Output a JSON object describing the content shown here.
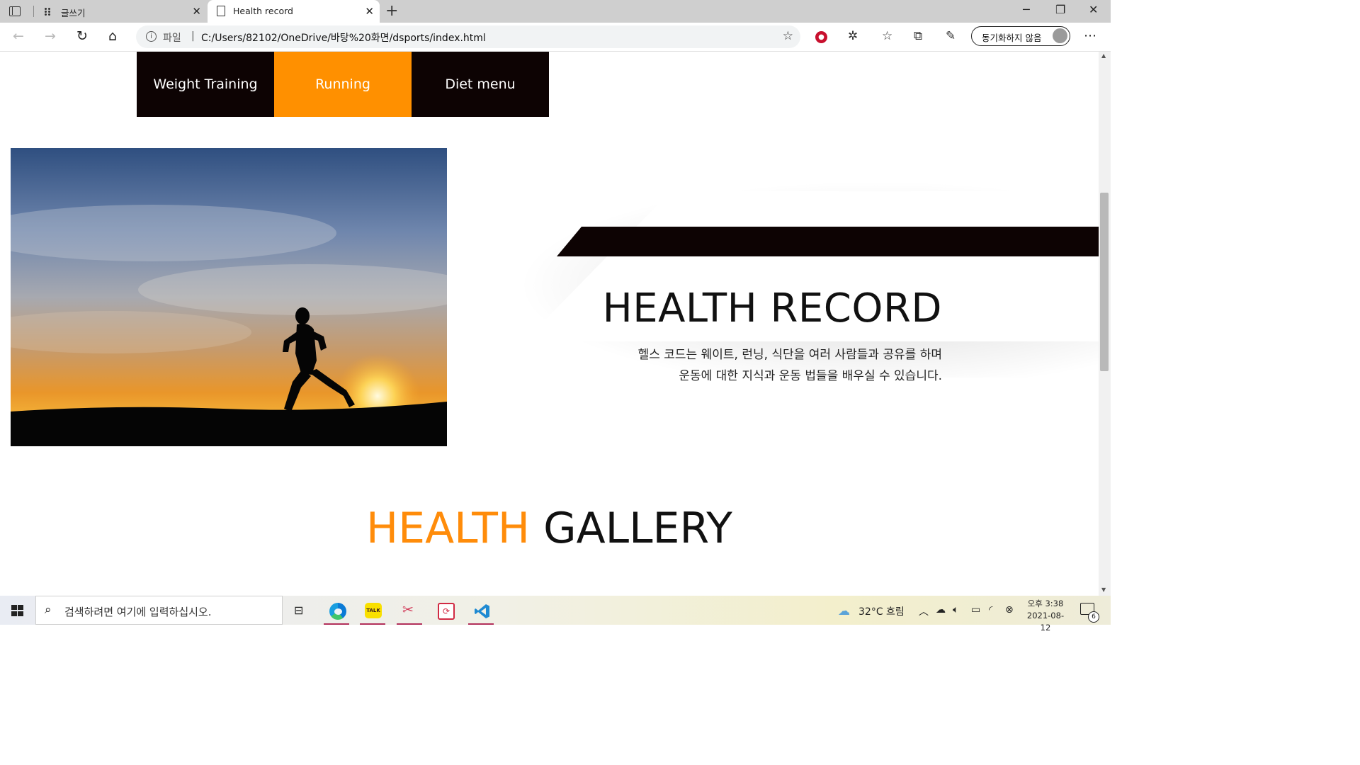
{
  "browser": {
    "tabs": [
      {
        "title": "글쓰기",
        "active": false
      },
      {
        "title": "Health record",
        "active": true
      }
    ],
    "address": {
      "label": "파일",
      "url": "C:/Users/82102/OneDrive/바탕%20화면/dsports/index.html"
    },
    "profile_label": "동기화하지 않음"
  },
  "page": {
    "menu": [
      {
        "label": "Weight Training",
        "active": false
      },
      {
        "label": "Running",
        "active": true
      },
      {
        "label": "Diet menu",
        "active": false
      }
    ],
    "hero": {
      "title": "HEALTH RECORD",
      "desc_line1": "헬스 코드는 웨이트, 런닝, 식단을 여러 사람들과 공유를 하며",
      "desc_line2": "운동에 대한 지식과 운동 법들을 배우실 수 있습니다."
    },
    "gallery": {
      "accent": "HEALTH",
      "rest": "GALLERY"
    },
    "colors": {
      "accent": "#ff9000",
      "dark": "#0d0303"
    }
  },
  "taskbar": {
    "search_placeholder": "검색하려면 여기에 입력하십시오.",
    "weather": "32°C  흐림",
    "time": "오후 3:38",
    "date": "2021-08-12",
    "notification_count": "6"
  }
}
